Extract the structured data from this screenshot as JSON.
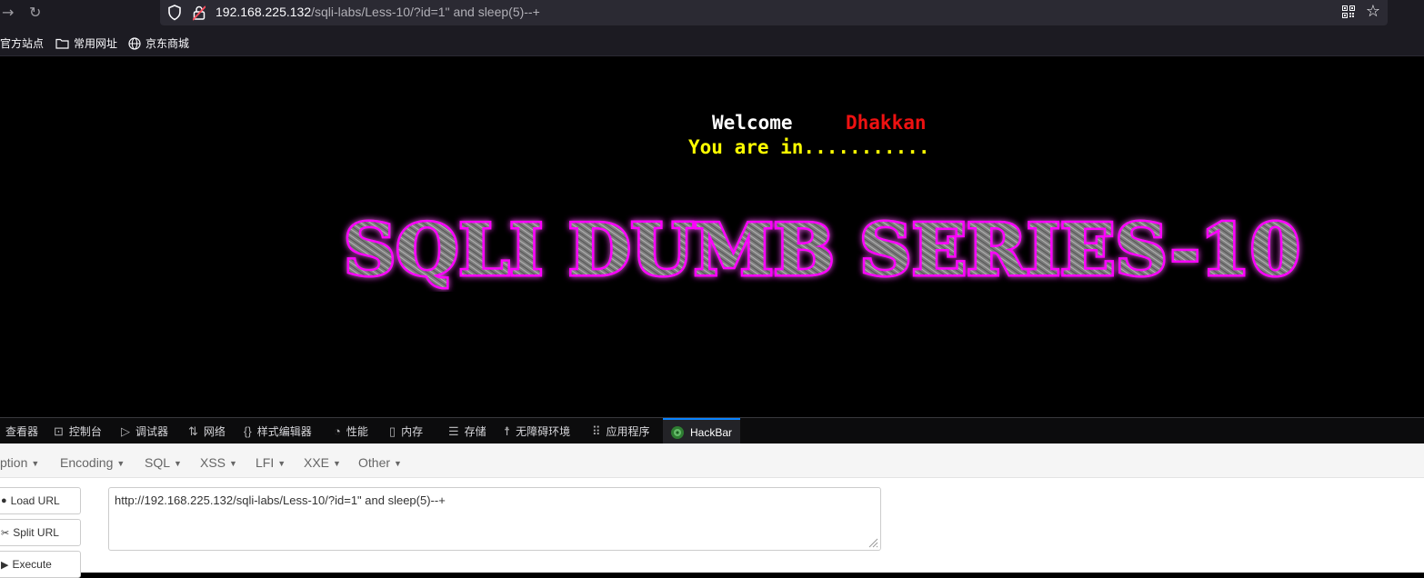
{
  "browser": {
    "url_host": "192.168.225.132",
    "url_path": "/sqli-labs/Less-10/?id=1\" and sleep(5)--+",
    "bookmarks": [
      {
        "label": "官方站点",
        "icon": "none"
      },
      {
        "label": "常用网址",
        "icon": "folder-icon"
      },
      {
        "label": "京东商城",
        "icon": "globe-icon"
      }
    ]
  },
  "page": {
    "welcome_label": "Welcome",
    "welcome_name": "Dhakkan",
    "status_text": "You are in...........",
    "logo_text": "SQLI DUMB SERIES-10"
  },
  "devtools": {
    "tabs": [
      {
        "label": "查看器",
        "icon": "inspector-icon"
      },
      {
        "label": "控制台",
        "icon": "console-icon"
      },
      {
        "label": "调试器",
        "icon": "debugger-icon"
      },
      {
        "label": "网络",
        "icon": "network-icon"
      },
      {
        "label": "样式编辑器",
        "icon": "style-editor-icon"
      },
      {
        "label": "性能",
        "icon": "performance-icon"
      },
      {
        "label": "内存",
        "icon": "memory-icon"
      },
      {
        "label": "存储",
        "icon": "storage-icon"
      },
      {
        "label": "无障碍环境",
        "icon": "accessibility-icon"
      },
      {
        "label": "应用程序",
        "icon": "application-icon"
      },
      {
        "label": "HackBar",
        "icon": "hackbar-icon",
        "active": true
      }
    ]
  },
  "hackbar": {
    "menu": [
      "ption",
      "Encoding",
      "SQL",
      "XSS",
      "LFI",
      "XXE",
      "Other"
    ],
    "buttons": {
      "load": "Load URL",
      "split": "Split URL",
      "execute": "Execute"
    },
    "url_value": "http://192.168.225.132/sqli-labs/Less-10/?id=1\" and sleep(5)--+"
  },
  "colors": {
    "welcome_name": "#ee1111",
    "status": "#ffff00",
    "logo_glow": "#ff00ff",
    "active_tab": "#0a84ff"
  }
}
